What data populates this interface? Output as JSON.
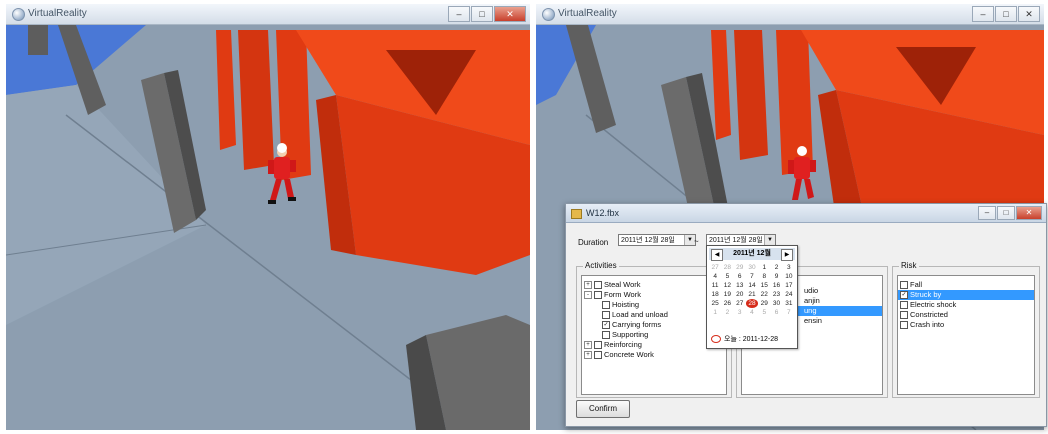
{
  "left_window": {
    "title": "VirtualReality"
  },
  "right_window": {
    "title": "VirtualReality"
  },
  "dialog": {
    "title": "W12.fbx",
    "duration_label": "Duration",
    "start_date": "2011년 12월 28일",
    "separator": "~",
    "end_date": "2011년 12월 28일",
    "confirm_label": "Confirm"
  },
  "activities": {
    "label": "Activities",
    "items": [
      {
        "text": "Steal Work",
        "expander": "+",
        "checked": false,
        "level": 0
      },
      {
        "text": "Form Work",
        "expander": "-",
        "checked": false,
        "level": 0
      },
      {
        "text": "Hoisting",
        "checked": false,
        "level": 1
      },
      {
        "text": "Load and unload",
        "checked": false,
        "level": 1
      },
      {
        "text": "Carrying forms",
        "checked": true,
        "level": 1
      },
      {
        "text": "Supporting",
        "checked": false,
        "level": 1
      },
      {
        "text": "Reinforcing",
        "expander": "+",
        "checked": false,
        "level": 0
      },
      {
        "text": "Concrete Work",
        "expander": "+",
        "checked": false,
        "level": 0
      }
    ]
  },
  "middle_list": {
    "items": [
      {
        "text": "udio",
        "selected": false
      },
      {
        "text": "anjin",
        "selected": false
      },
      {
        "text": "ung",
        "selected": true
      },
      {
        "text": "ensin",
        "selected": false
      }
    ]
  },
  "risk": {
    "label": "Risk",
    "items": [
      {
        "text": "Fall",
        "checked": false,
        "selected": false
      },
      {
        "text": "Struck by",
        "checked": true,
        "selected": true
      },
      {
        "text": "Electric shock",
        "checked": false,
        "selected": false
      },
      {
        "text": "Constricted",
        "checked": false,
        "selected": false
      },
      {
        "text": "Crash into",
        "checked": false,
        "selected": false
      }
    ]
  },
  "calendar": {
    "month_title": "2011년 12월",
    "weeks": [
      [
        "27",
        "28",
        "29",
        "30",
        "1",
        "2",
        "3"
      ],
      [
        "4",
        "5",
        "6",
        "7",
        "8",
        "9",
        "10"
      ],
      [
        "11",
        "12",
        "13",
        "14",
        "15",
        "16",
        "17"
      ],
      [
        "18",
        "19",
        "20",
        "21",
        "22",
        "23",
        "24"
      ],
      [
        "25",
        "26",
        "27",
        "28",
        "29",
        "30",
        "31"
      ],
      [
        "1",
        "2",
        "3",
        "4",
        "5",
        "6",
        "7"
      ]
    ],
    "muted_first_row_count": 4,
    "muted_last_row": true,
    "today_cell": "28",
    "today_label": "오늘 : 2011-12-28"
  },
  "colors": {
    "wall": "#e03a12",
    "floor": "#8d9eb0",
    "pillar": "#5d5d5d",
    "sky": "#4a78d6",
    "selection": "#3399ff"
  }
}
